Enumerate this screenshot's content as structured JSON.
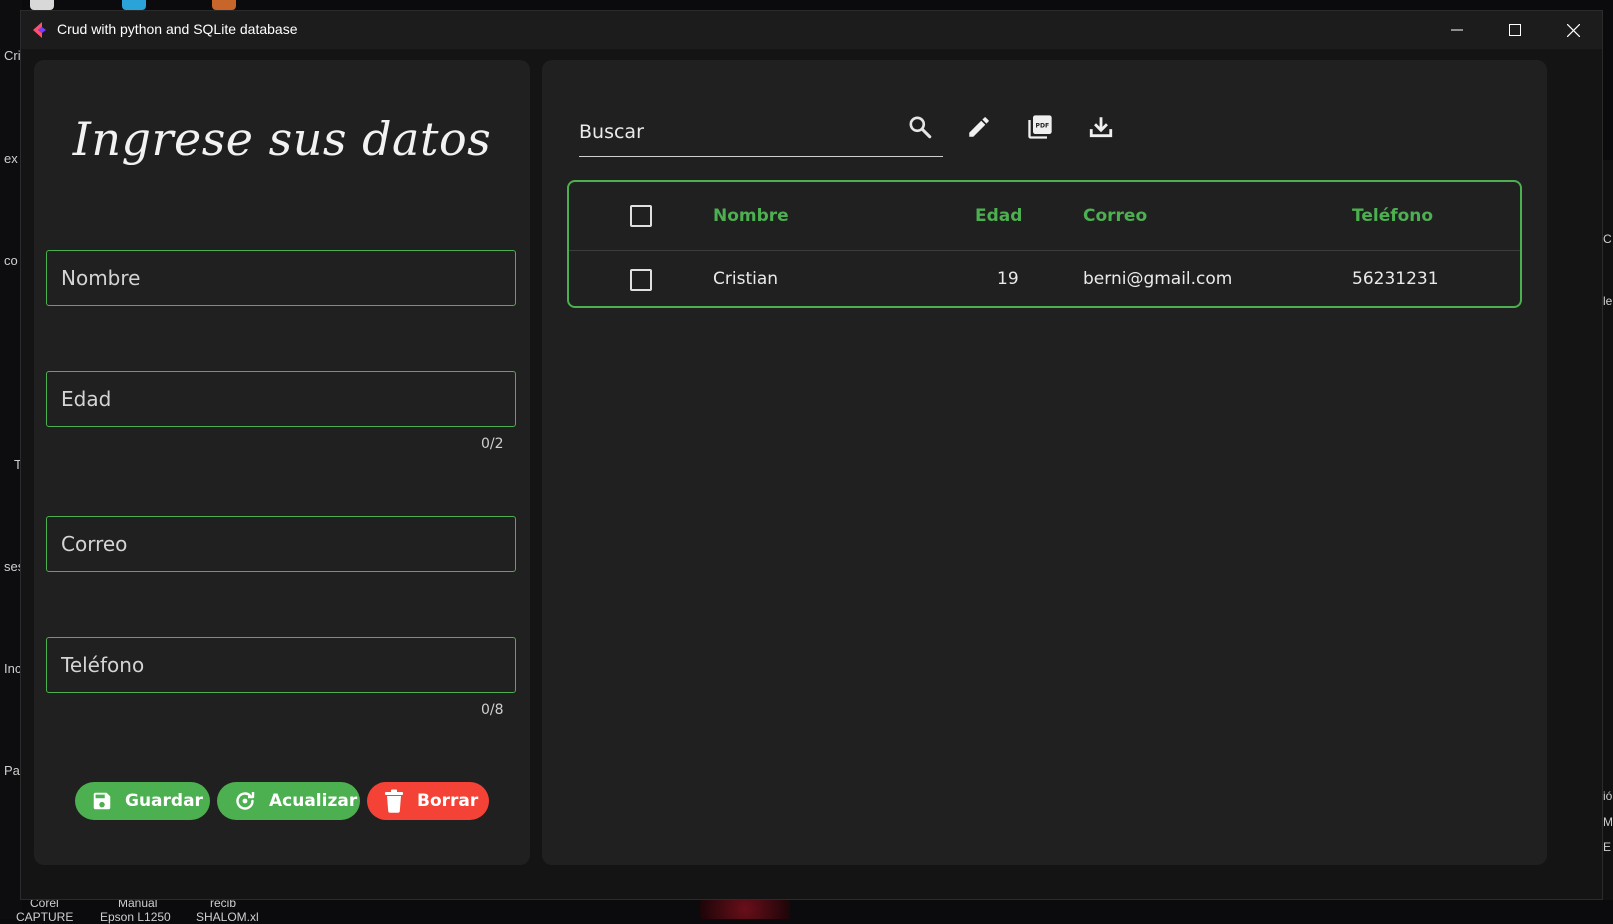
{
  "window": {
    "title": "Crud with python and SQLite database",
    "controls": [
      "minimize-icon",
      "maximize-icon",
      "close-icon"
    ]
  },
  "form": {
    "heading": "Ingrese sus datos",
    "nombre": {
      "placeholder": "Nombre",
      "value": ""
    },
    "edad": {
      "placeholder": "Edad",
      "value": "",
      "counter": "0/2"
    },
    "correo": {
      "placeholder": "Correo",
      "value": ""
    },
    "telefono": {
      "placeholder": "Teléfono",
      "value": "",
      "counter": "0/8"
    },
    "buttons": {
      "guardar": {
        "label": "Guardar",
        "icon": "save-icon"
      },
      "actualizar": {
        "label": "Acualizar",
        "icon": "refresh-icon"
      },
      "borrar": {
        "label": "Borrar",
        "icon": "trash-icon"
      }
    }
  },
  "search": {
    "placeholder": "Buscar",
    "value": ""
  },
  "toolbar": {
    "icons": [
      "search-icon",
      "edit-icon",
      "pdf-icon",
      "download-icon"
    ]
  },
  "table": {
    "columns": [
      "Nombre",
      "Edad",
      "Correo",
      "Teléfono"
    ],
    "rows": [
      {
        "nombre": "Cristian",
        "edad": "19",
        "correo": "berni@gmail.com",
        "telefono": "56231231"
      }
    ]
  },
  "colors": {
    "accent": "#4caf50",
    "danger": "#f44336",
    "panel": "#202020",
    "window": "#141414"
  },
  "background": {
    "left_fragments": [
      "Cri",
      "ex",
      "co",
      "T",
      "ses",
      "Inc",
      "Pa"
    ],
    "right_fragments": [
      "C",
      "le",
      "ió",
      "M",
      "E"
    ],
    "taskbar_labels": [
      "Corel",
      "Manual",
      "recib",
      "CAPTURE",
      "Epson L1250",
      "SHALOM.xl"
    ]
  }
}
